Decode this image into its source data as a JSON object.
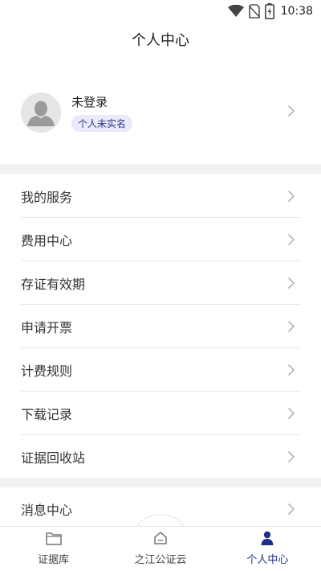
{
  "status_bar": {
    "time": "10:38",
    "icons": [
      "wifi-icon",
      "no-sim-icon",
      "battery-charging-icon"
    ]
  },
  "header": {
    "title": "个人中心"
  },
  "profile": {
    "name": "未登录",
    "badge": "个人未实名",
    "avatar_icon": "user-silhouette-icon"
  },
  "menu": {
    "items": [
      {
        "label": "我的服务"
      },
      {
        "label": "费用中心"
      },
      {
        "label": "存证有效期"
      },
      {
        "label": "申请开票"
      },
      {
        "label": "计费规则"
      },
      {
        "label": "下载记录"
      },
      {
        "label": "证据回收站"
      }
    ],
    "items2": [
      {
        "label": "消息中心"
      }
    ]
  },
  "tabs": [
    {
      "label": "证据库",
      "icon": "folder-icon",
      "active": false
    },
    {
      "label": "之江公证云",
      "icon": "home-icon",
      "active": false
    },
    {
      "label": "个人中心",
      "icon": "person-icon",
      "active": true
    }
  ],
  "colors": {
    "accent": "#1e2f86",
    "badge_bg": "#eaeafa",
    "separator": "#f2f2f2"
  }
}
